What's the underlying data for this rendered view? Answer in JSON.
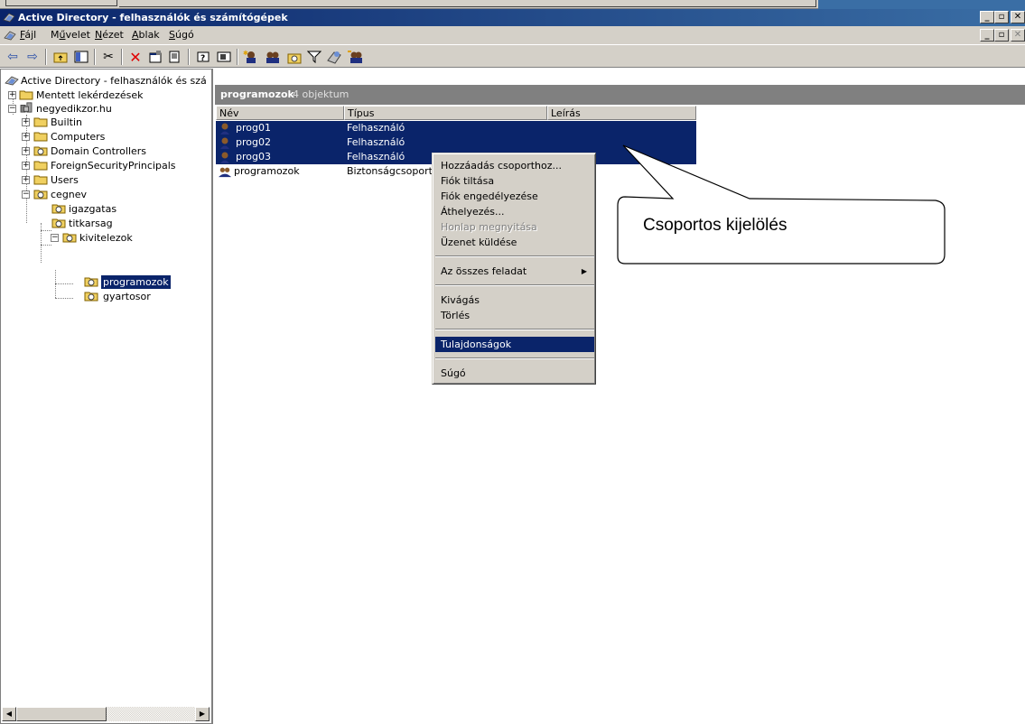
{
  "window": {
    "title": "Active Directory - felhasználók és számítógépek",
    "caption_buttons": [
      "_",
      "̲",
      "×"
    ]
  },
  "menu": {
    "items": [
      {
        "pre": "",
        "u": "F",
        "post": "ájl"
      },
      {
        "pre": "M",
        "u": "ű",
        "post": "velet"
      },
      {
        "pre": "",
        "u": "N",
        "post": "ézet"
      },
      {
        "pre": "",
        "u": "A",
        "post": "blak"
      },
      {
        "pre": "",
        "u": "S",
        "post": "úgó"
      }
    ]
  },
  "tree": {
    "root": "Active Directory - felhasználók és szá",
    "saved_queries": "Mentett lekérdezések",
    "domain": "negyedikzor.hu",
    "builtin": "Builtin",
    "computers": "Computers",
    "domain_controllers": "Domain Controllers",
    "foreign": "ForeignSecurityPrincipals",
    "users": "Users",
    "cegnev": "cegnev",
    "igazgatas": "igazgatas",
    "titkarsag": "titkarsag",
    "kivitelezok": "kivitelezok",
    "programozok": "programozok",
    "gyartosor": "gyartosor"
  },
  "details": {
    "header_title": "programozok",
    "header_count": "4 objektum",
    "columns": [
      "Név",
      "Típus",
      "Leírás"
    ],
    "rows": [
      {
        "name": "prog01",
        "type": "Felhasználó",
        "selected": true
      },
      {
        "name": "prog02",
        "type": "Felhasználó",
        "selected": true
      },
      {
        "name": "prog03",
        "type": "Felhasználó",
        "selected": true
      },
      {
        "name": "programozok",
        "type": "Biztonságcsoport",
        "selected": false
      }
    ]
  },
  "context_menu": {
    "add_to_group": "Hozzáadás csoporthoz...",
    "disable_account": "Fiók tiltása",
    "enable_account": "Fiók engedélyezése",
    "move": "Áthelyezés...",
    "open_homepage": "Honlap megnyitása",
    "send_message": "Üzenet küldése",
    "all_tasks": "Az összes feladat",
    "cut": "Kivágás",
    "delete": "Törlés",
    "properties": "Tulajdonságok",
    "help": "Súgó"
  },
  "callout": {
    "text": "Csoportos kijelölés"
  },
  "colors": {
    "selection": "#0a246a",
    "face": "#d4d0c8",
    "header_gray": "#808080"
  }
}
